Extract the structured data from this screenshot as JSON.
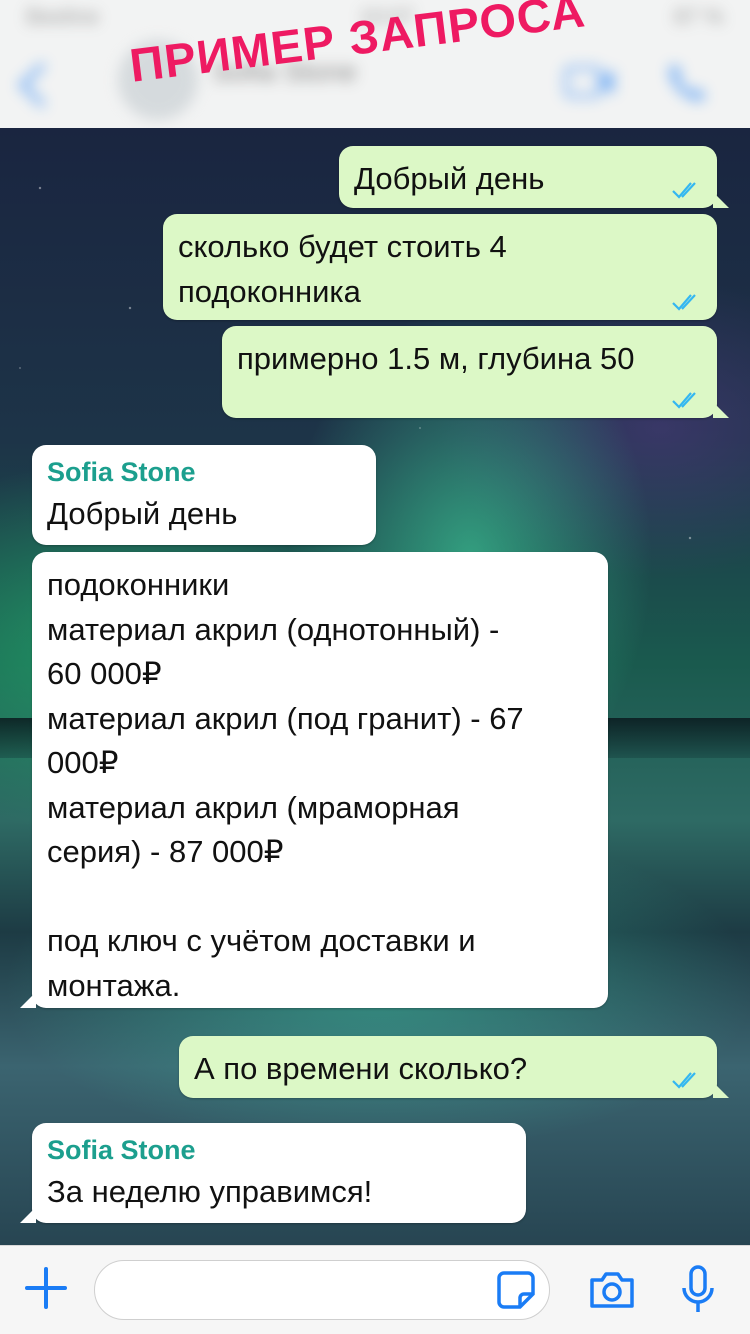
{
  "header": {
    "status_carrier": "Beeline",
    "status_time": "10:07",
    "status_battery": "87 %",
    "contact_name": "Sofia Stone",
    "watermark": "ПРИМЕР ЗАПРОСА"
  },
  "messages": [
    {
      "direction": "out",
      "text": "Добрый день",
      "read": true
    },
    {
      "direction": "out",
      "text": "сколько будет стоить 4\nподоконника",
      "read": true
    },
    {
      "direction": "out",
      "text": "примерно 1.5 м, глубина 50",
      "read": true
    },
    {
      "direction": "in",
      "sender": "Sofia Stone",
      "text": "Добрый день"
    },
    {
      "direction": "in",
      "text": "подоконники\nматериал акрил (однотонный) -\n60 000₽\nматериал акрил (под гранит) - 67\n000₽\nматериал акрил (мраморная\nсерия) - 87 000₽\n\nпод ключ с учётом доставки и\nмонтажа."
    },
    {
      "direction": "out",
      "text": "А по времени сколько?",
      "read": true
    },
    {
      "direction": "in",
      "sender": "Sofia Stone",
      "text": "За неделю управимся!"
    }
  ],
  "input": {
    "placeholder": ""
  },
  "colors": {
    "outgoing_bubble": "#dcf8c6",
    "incoming_bubble": "#ffffff",
    "sender_name": "#1c9f8e",
    "watermark": "#ee1a62",
    "ios_blue": "#1a7cf5",
    "read_ticks": "#34b7f1"
  }
}
